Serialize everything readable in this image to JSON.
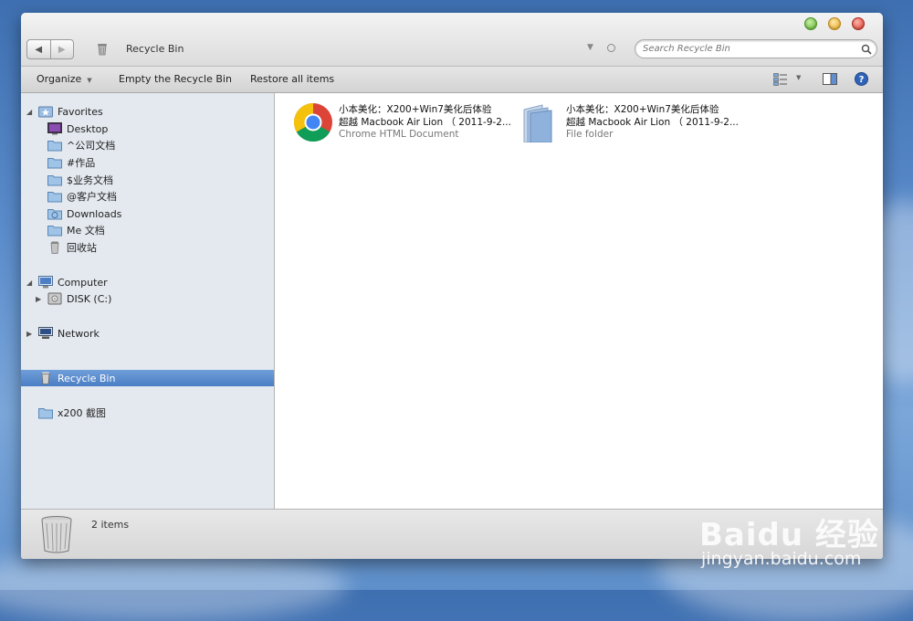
{
  "window": {
    "title": "Recycle Bin",
    "search_placeholder": "Search Recycle Bin"
  },
  "toolbar": {
    "organize": "Organize",
    "empty": "Empty the Recycle Bin",
    "restore": "Restore all items"
  },
  "sidebar": {
    "favorites": {
      "label": "Favorites",
      "items": [
        {
          "label": "Desktop",
          "icon": "desktop-icon"
        },
        {
          "label": "^公司文档",
          "icon": "folder-icon"
        },
        {
          "label": "#作品",
          "icon": "folder-icon"
        },
        {
          "label": "$业务文档",
          "icon": "folder-icon"
        },
        {
          "label": "@客户文档",
          "icon": "folder-icon"
        },
        {
          "label": "Downloads",
          "icon": "downloads-folder-icon"
        },
        {
          "label": "Me 文档",
          "icon": "folder-icon"
        },
        {
          "label": "回收站",
          "icon": "trash-icon"
        }
      ]
    },
    "computer": {
      "label": "Computer",
      "disk": "DISK (C:)"
    },
    "network": {
      "label": "Network"
    },
    "recycle_bin": {
      "label": "Recycle Bin"
    },
    "extra_folder": {
      "label": "x200 截图"
    }
  },
  "files": [
    {
      "name_line1": "小本美化：X200+Win7美化后体验",
      "name_line2": "超越 Macbook Air Lion （ 2011-9-2...",
      "type": "Chrome HTML Document",
      "icon": "chrome-icon"
    },
    {
      "name_line1": "小本美化：X200+Win7美化后体验",
      "name_line2": "超越 Macbook Air Lion （ 2011-9-2...",
      "type": "File folder",
      "icon": "folder-icon"
    }
  ],
  "status": {
    "count_text": "2 items"
  },
  "watermark": {
    "logo": "Baidu 经验",
    "url": "jingyan.baidu.com"
  },
  "colors": {
    "selection": "#4a7dc4",
    "sidebar_bg": "#e4e9ef"
  }
}
